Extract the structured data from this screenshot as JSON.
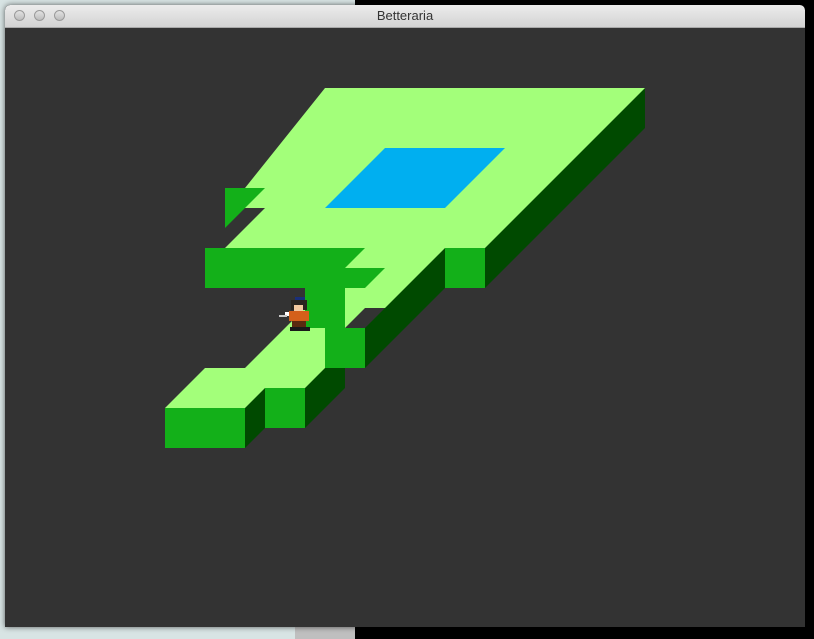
{
  "window": {
    "title": "Betteraria"
  },
  "controls": {
    "close": "close-icon",
    "minimize": "minimize-icon",
    "zoom": "zoom-icon"
  },
  "scene": {
    "background": "#333333",
    "colors": {
      "grass_top": "#a3ff7a",
      "grass_side_front": "#13b019",
      "grass_side_dark": "#004a00",
      "water": "#00aff0"
    },
    "tiles": [
      "grass-platform",
      "water-pool",
      "player-sprite"
    ]
  }
}
